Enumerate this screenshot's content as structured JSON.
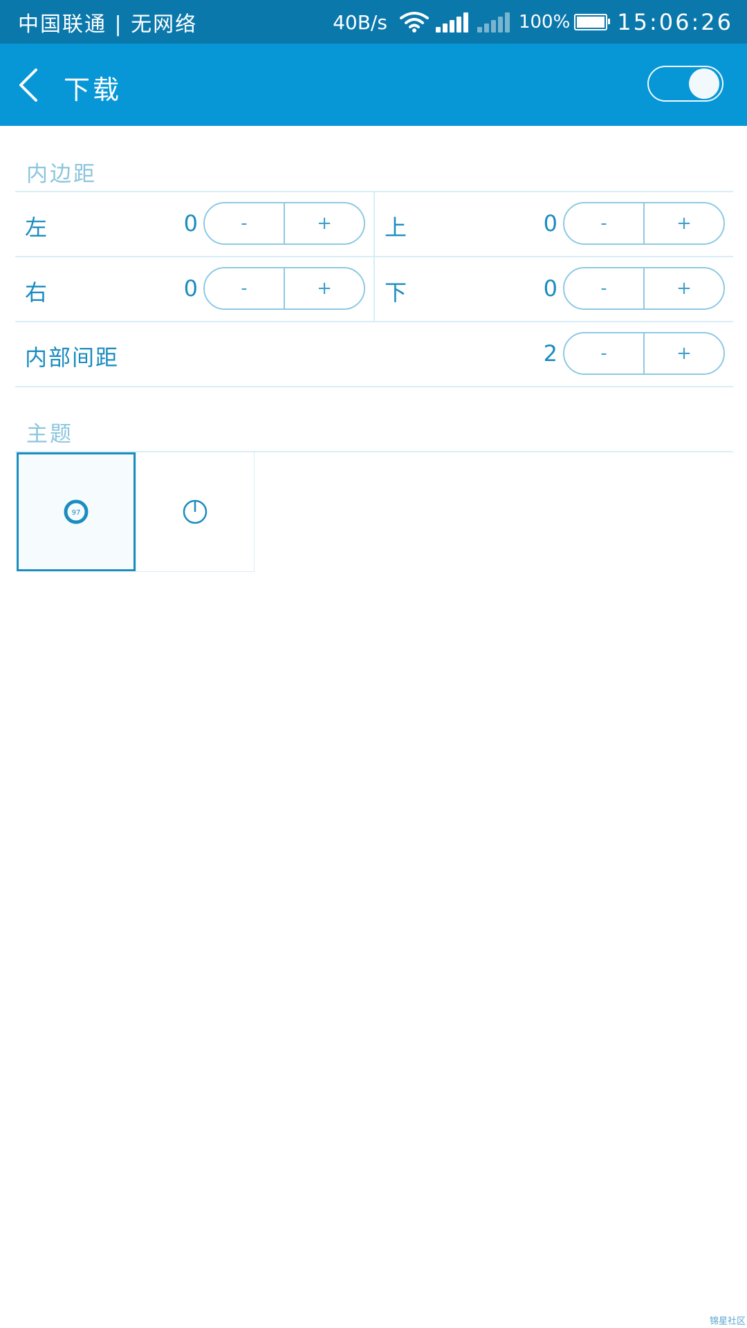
{
  "status_bar": {
    "carrier": "中国联通 | 无网络",
    "net_speed": "40B/s",
    "battery_percent": "100%",
    "time": "15:06:26"
  },
  "app_bar": {
    "back_icon": "chevron-left-icon",
    "title": "下载",
    "toggle_on": true
  },
  "padding_section": {
    "title": "内边距",
    "left": {
      "label": "左",
      "value": "0",
      "minus": "-",
      "plus": "+"
    },
    "top": {
      "label": "上",
      "value": "0",
      "minus": "-",
      "plus": "+"
    },
    "right": {
      "label": "右",
      "value": "0",
      "minus": "-",
      "plus": "+"
    },
    "bottom": {
      "label": "下",
      "value": "0",
      "minus": "-",
      "plus": "+"
    },
    "inner_spacing": {
      "label": "内部间距",
      "value": "2",
      "minus": "-",
      "plus": "+"
    }
  },
  "theme_section": {
    "title": "主题",
    "options": [
      {
        "icon": "ring-progress-icon",
        "label": "97",
        "selected": true
      },
      {
        "icon": "circle-dial-icon",
        "selected": false
      }
    ]
  },
  "watermark": "锦星社区",
  "colors": {
    "status_bar": "#0b78ac",
    "app_bar": "#0797d6",
    "accent": "#1a8cc0",
    "divider": "#d7edf6"
  }
}
